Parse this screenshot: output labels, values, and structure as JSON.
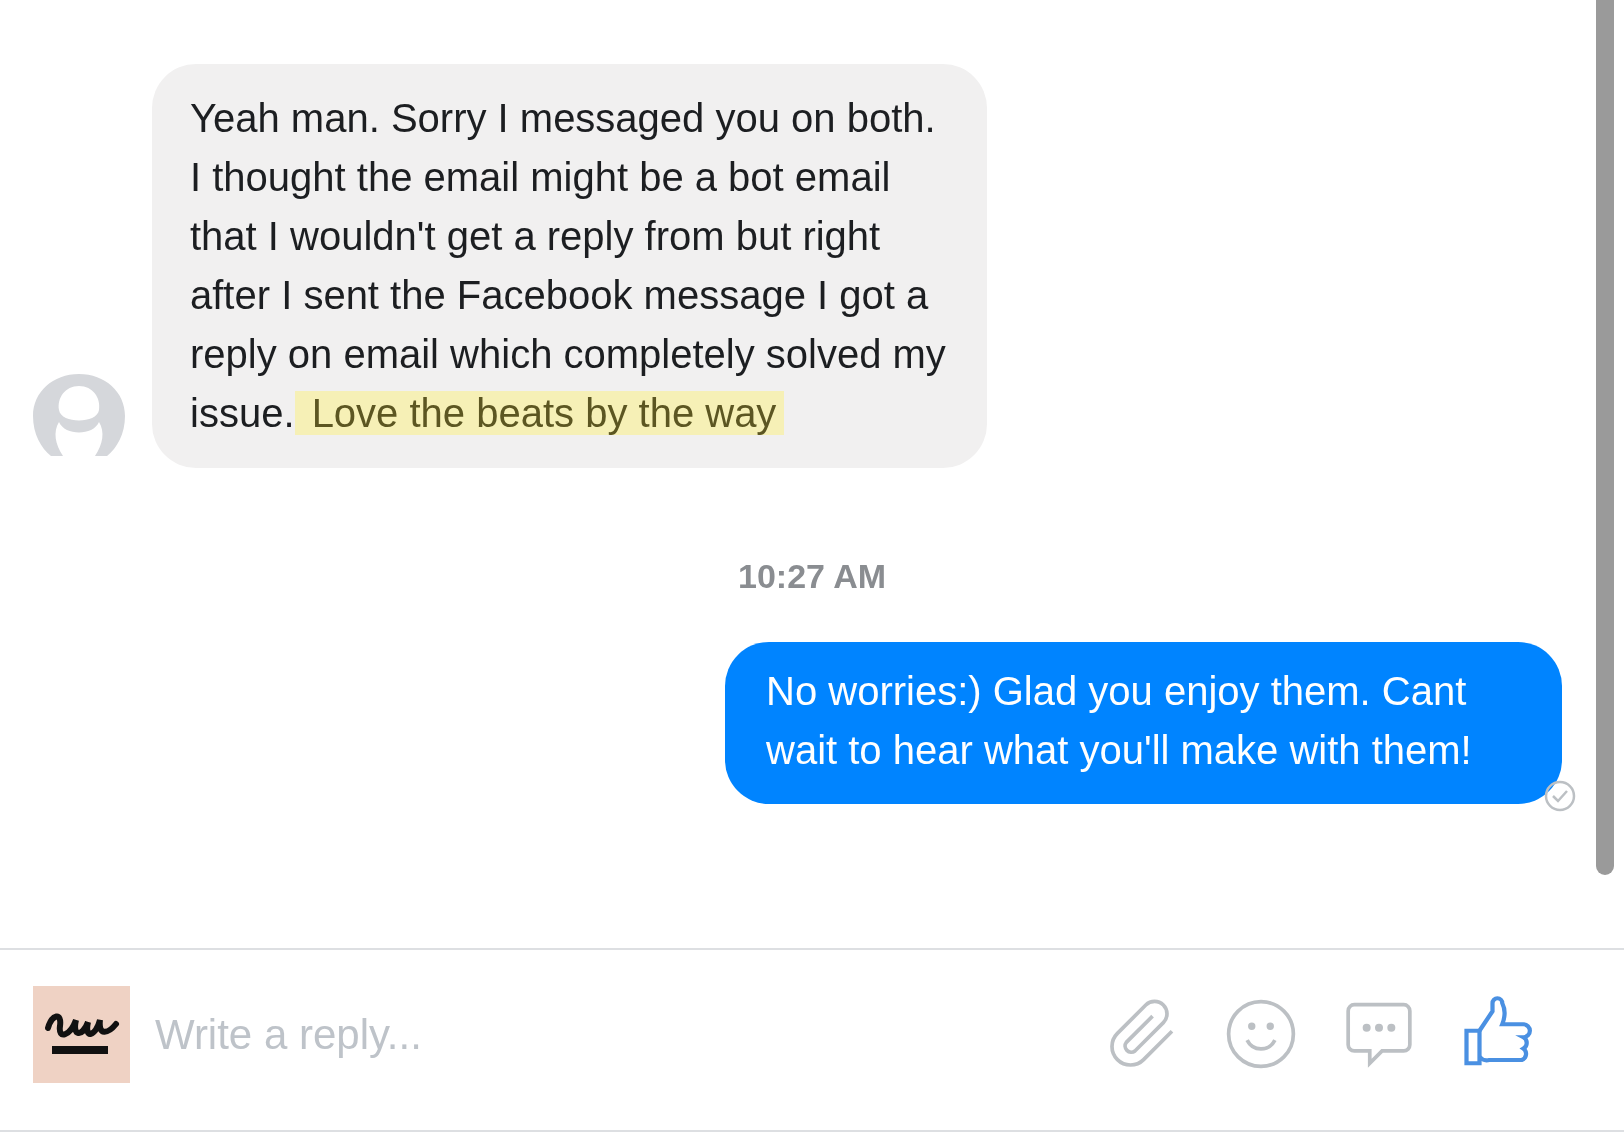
{
  "messages": [
    {
      "kind": "incoming",
      "parts": [
        {
          "text": "Yeah man. Sorry I messaged you on both. I thought the email might be a bot email that I wouldn't get a reply from but right after I sent the Facebook message I got a reply on email which completely solved my issue.",
          "highlighted": false
        },
        {
          "text": "Love the beats by the way",
          "highlighted": true
        }
      ]
    },
    {
      "kind": "timestamp",
      "text": "10:27 AM"
    },
    {
      "kind": "outgoing",
      "parts": [
        {
          "text": "No worries:) Glad you enjoy them. Cant wait to hear what you'll make with them!",
          "highlighted": false
        }
      ],
      "seen": true
    }
  ],
  "composer": {
    "placeholder": "Write a reply..."
  }
}
